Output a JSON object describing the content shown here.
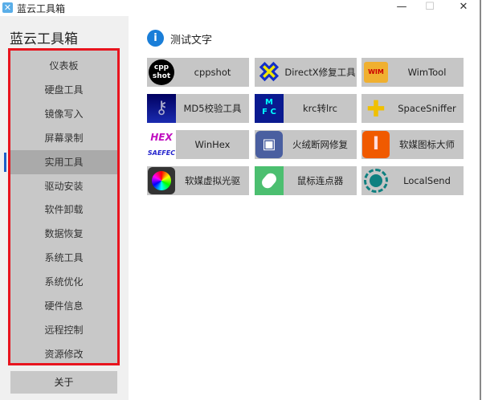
{
  "window": {
    "title": "蓝云工具箱",
    "minimize": "—",
    "maximize": "☐",
    "close": "✕"
  },
  "sidebar": {
    "title": "蓝云工具箱",
    "items": [
      {
        "label": "仪表板"
      },
      {
        "label": "硬盘工具"
      },
      {
        "label": "镜像写入"
      },
      {
        "label": "屏幕录制"
      },
      {
        "label": "实用工具",
        "selected": true
      },
      {
        "label": "驱动安装"
      },
      {
        "label": "软件卸载"
      },
      {
        "label": "数据恢复"
      },
      {
        "label": "系统工具"
      },
      {
        "label": "系统优化"
      },
      {
        "label": "硬件信息"
      },
      {
        "label": "远程控制"
      },
      {
        "label": "资源修改"
      }
    ],
    "about": "关于"
  },
  "main": {
    "header": "测试文字",
    "info_icon": "i",
    "tools": [
      {
        "label": "cppshot",
        "icon": "cpp",
        "color": "#000000"
      },
      {
        "label": "DirectX修复工具",
        "icon": "X",
        "color": "#f2e600"
      },
      {
        "label": "WimTool",
        "icon": "WIM",
        "color": "#f0b030"
      },
      {
        "label": "MD5校验工具",
        "icon": "key",
        "color": "#1a2bb0"
      },
      {
        "label": "krc转lrc",
        "icon": "MFC",
        "color": "#0a1a90"
      },
      {
        "label": "SpaceSniffer",
        "icon": "puzzle",
        "color": "#f0c000"
      },
      {
        "label": "WinHex",
        "icon": "HEX",
        "color": "#c010c0"
      },
      {
        "label": "火绒断网修复",
        "icon": "+",
        "color": "#4a5fa0"
      },
      {
        "label": "软媒图标大师",
        "icon": "I",
        "color": "#f05a00"
      },
      {
        "label": "软媒虚拟光驱",
        "icon": "disc",
        "color": "#333333"
      },
      {
        "label": "鼠标连点器",
        "icon": "mouse",
        "color": "#4cbf70"
      },
      {
        "label": "LocalSend",
        "icon": "●",
        "color": "#0f8080"
      }
    ]
  }
}
